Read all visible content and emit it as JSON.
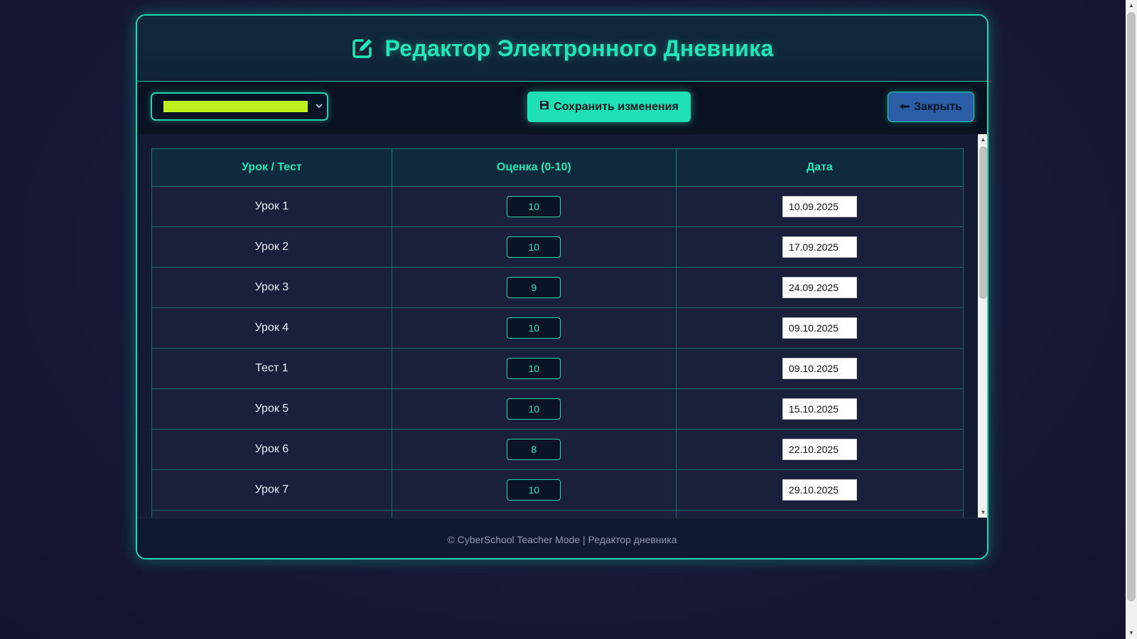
{
  "header": {
    "title": "Редактор Электронного Дневника",
    "icon": "edit-icon"
  },
  "toolbar": {
    "student_select_value": "",
    "save_label": "Сохранить изменения",
    "close_label": "Закрыть"
  },
  "table": {
    "columns": [
      "Урок / Тест",
      "Оценка (0-10)",
      "Дата"
    ],
    "rows": [
      {
        "lesson": "Урок 1",
        "grade": "10",
        "date": "10.09.2025"
      },
      {
        "lesson": "Урок 2",
        "grade": "10",
        "date": "17.09.2025"
      },
      {
        "lesson": "Урок 3",
        "grade": "9",
        "date": "24.09.2025"
      },
      {
        "lesson": "Урок 4",
        "grade": "10",
        "date": "09.10.2025"
      },
      {
        "lesson": "Тест 1",
        "grade": "10",
        "date": "09.10.2025"
      },
      {
        "lesson": "Урок 5",
        "grade": "10",
        "date": "15.10.2025"
      },
      {
        "lesson": "Урок 6",
        "grade": "8",
        "date": "22.10.2025"
      },
      {
        "lesson": "Урок 7",
        "grade": "10",
        "date": "29.10.2025"
      }
    ]
  },
  "footer": {
    "text": "© CyberSchool Teacher Mode | Редактор дневника"
  },
  "colors": {
    "accent": "#22e6b8",
    "close_button": "#2a5fa8",
    "selected_highlight": "#bff01f"
  }
}
